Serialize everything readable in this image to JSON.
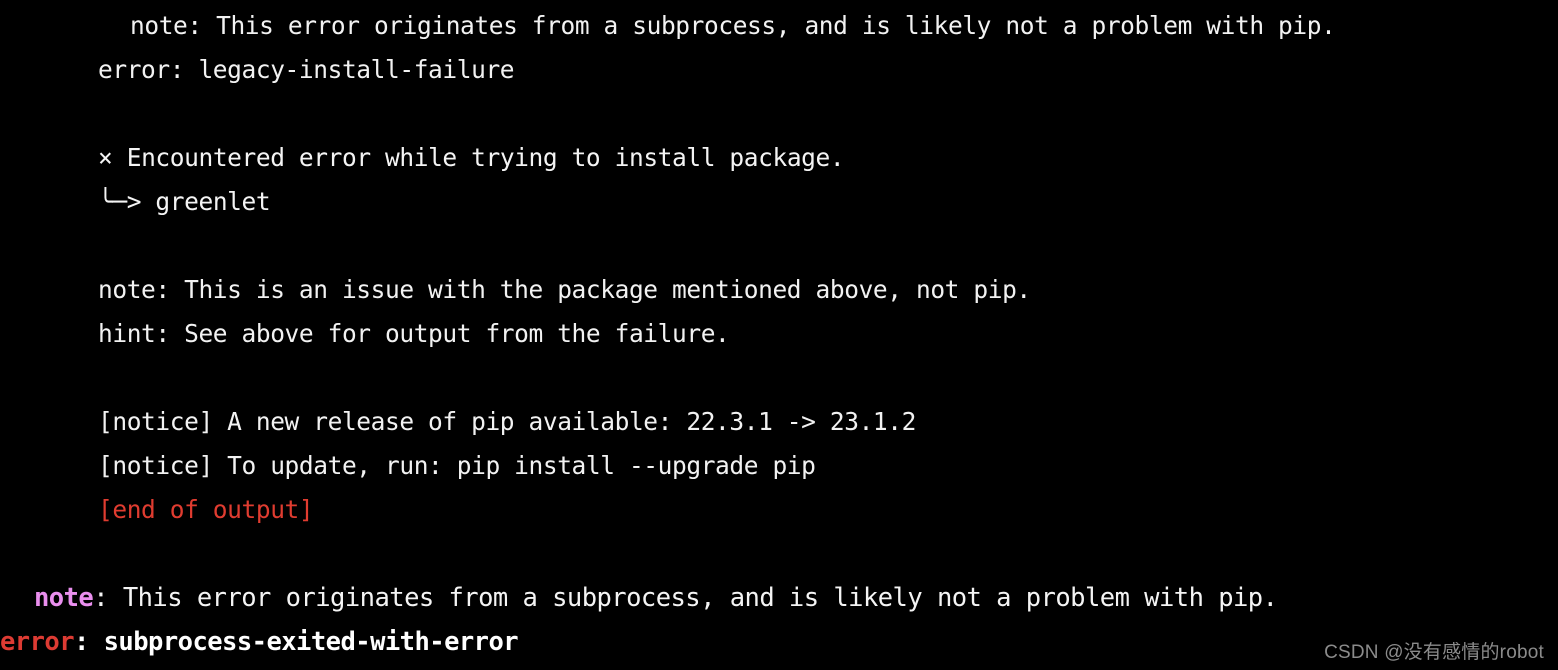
{
  "terminal": {
    "background_color": "#000000",
    "default_text_color": "#f2f2f2",
    "accent_colors": {
      "error_red": "#e03c30",
      "note_magenta": "#ea8fee",
      "white": "#ffffff",
      "watermark_gray": "#8b8b8b"
    },
    "lines": {
      "l1_note_subprocess": "note: This error originates from a subprocess, and is likely not a problem with pip.",
      "l2_error_legacy": "error: legacy-install-failure",
      "l3_cross_glyph": "×",
      "l3_encountered": "Encountered error while trying to install package.",
      "l4_arrow_glyph": "╰─>",
      "l4_package": "greenlet",
      "l5_note_issue": "note: This is an issue with the package mentioned above, not pip.",
      "l6_hint": "hint: See above for output from the failure.",
      "l7_notice_release": "[notice] A new release of pip available: 22.3.1 -> 23.1.2",
      "l8_notice_update": "[notice] To update, run: pip install --upgrade pip",
      "l9_end_of_output": "[end of output]",
      "l10_note_label": "note",
      "l10_note_rest": ": This error originates from a subprocess, and is likely not a problem with pip.",
      "l11_error_label": "error",
      "l11_error_colon": ": ",
      "l11_error_value": "subprocess-exited-with-error"
    }
  },
  "watermark": {
    "text": "CSDN @没有感情的robot"
  }
}
